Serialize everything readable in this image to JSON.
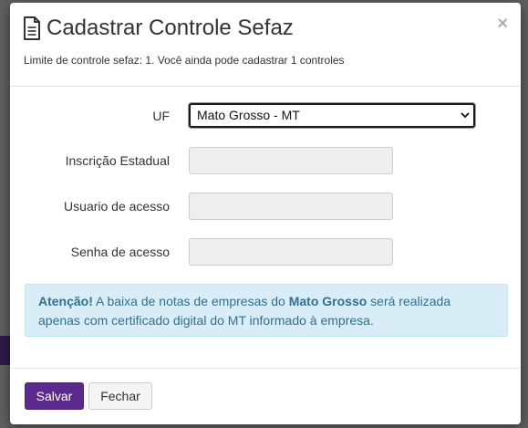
{
  "modal": {
    "title": "Cadastrar Controle Sefaz",
    "close_symbol": "×",
    "subtitle": "Limite de controle sefaz: 1. Você ainda pode cadastrar 1 controles",
    "icons": {
      "title": "document-icon",
      "close": "close-icon"
    }
  },
  "form": {
    "uf_label": "UF",
    "uf_value": "Mato Grosso - MT",
    "inscricao_label": "Inscrição Estadual",
    "inscricao_value": "",
    "usuario_label": "Usuario de acesso",
    "usuario_value": "",
    "senha_label": "Senha de acesso",
    "senha_value": ""
  },
  "alert": {
    "prefix": "Atenção!",
    "text_1": " A baixa de notas de empresas do ",
    "state": "Mato Grosso",
    "text_2": " será realizada apenas com certificado digital do MT informado à empresa."
  },
  "footer": {
    "save_label": "Salvar",
    "close_label": "Fechar"
  },
  "colors": {
    "primary_button": "#5b2a8e",
    "alert_background": "#d9edf7",
    "alert_text": "#31708f",
    "overlay": "#5f5f5f"
  }
}
